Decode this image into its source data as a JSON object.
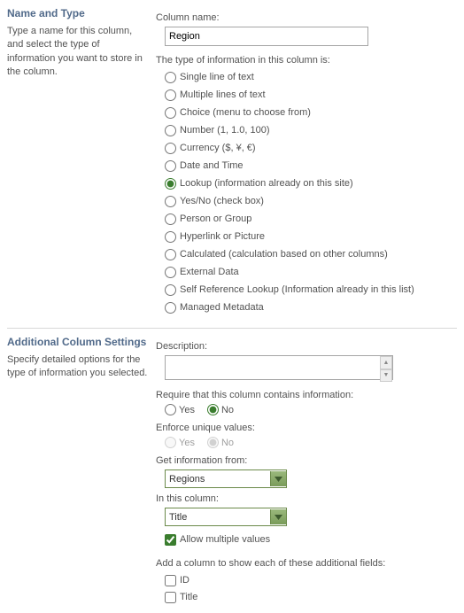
{
  "section1": {
    "heading": "Name and Type",
    "desc": "Type a name for this column, and select the type of information you want to store in the column."
  },
  "col_name_label": "Column name:",
  "col_name_value": "Region",
  "type_intro": "The type of information in this column is:",
  "types": {
    "t0": "Single line of text",
    "t1": "Multiple lines of text",
    "t2": "Choice (menu to choose from)",
    "t3": "Number (1, 1.0, 100)",
    "t4": "Currency ($, ¥, €)",
    "t5": "Date and Time",
    "t6": "Lookup (information already on this site)",
    "t7": "Yes/No (check box)",
    "t8": "Person or Group",
    "t9": "Hyperlink or Picture",
    "t10": "Calculated (calculation based on other columns)",
    "t11": "External Data",
    "t12": "Self Reference Lookup (Information already in this list)",
    "t13": "Managed Metadata"
  },
  "section2": {
    "heading": "Additional Column Settings",
    "desc": "Specify detailed options for the type of information you selected."
  },
  "desc_label": "Description:",
  "require_label": "Require that this column contains information:",
  "yes": "Yes",
  "no": "No",
  "enforce_label": "Enforce unique values:",
  "get_from_label": "Get information from:",
  "get_from_value": "Regions",
  "in_col_label": "In this column:",
  "in_col_value": "Title",
  "allow_multi": "Allow multiple values",
  "add_col_label": "Add a column to show each of these additional fields:",
  "extra": {
    "id": "ID",
    "title": "Title"
  }
}
